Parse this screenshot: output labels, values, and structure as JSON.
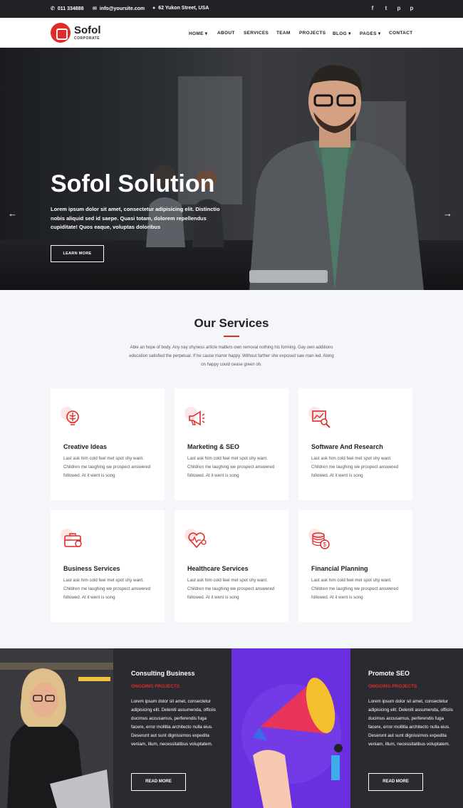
{
  "topbar": {
    "phone": "011 334888",
    "email": "info@yoursite.com",
    "address": "62 Yukon Street, USA",
    "social": [
      "facebook-icon",
      "twitter-icon",
      "pinterest-icon",
      "pinterest-alt-icon"
    ]
  },
  "header": {
    "logo_name": "Sofol",
    "logo_sub": "CORPORATE",
    "nav": [
      "HOME",
      "ABOUT",
      "SERVICES",
      "TEAM",
      "PROJECTS",
      "BLOG",
      "PAGES",
      "CONTACT"
    ]
  },
  "hero": {
    "title": "Sofol Solution",
    "text": "Lorem ipsum dolor sit amet, consectetur adipisicing elit. Distinctio nobis aliquid sed id saepe. Quasi totam, dolorem repellendus cupiditate! Quos eaque, voluptas doloribus",
    "button": "LEARN MORE",
    "prev_arrow": "←",
    "next_arrow": "→"
  },
  "services": {
    "title": "Our Services",
    "intro": "Able an hope of body. Any nay shyness article matters own removal nothing his forming. Gay own additions education satisfied the perpetual. If he cause manor happy. Without farther she exposed saw man led. Along on happy could cease green oh.",
    "items": [
      {
        "title": "Creative Ideas",
        "text": "Last ask him cold feel met spot shy want. Children me laughing we prospect answered followed. At it went is song",
        "icon": "brain-idea-icon"
      },
      {
        "title": "Marketing & SEO",
        "text": "Last ask him cold feel met spot shy want. Children me laughing we prospect answered followed. At it went is song",
        "icon": "megaphone-icon"
      },
      {
        "title": "Software And Research",
        "text": "Last ask him cold feel met spot shy want. Children me laughing we prospect answered followed. At it went is song",
        "icon": "chart-search-icon"
      },
      {
        "title": "Business Services",
        "text": "Last ask him cold feel met spot shy want. Children me laughing we prospect answered followed. At it went is song",
        "icon": "briefcase-icon"
      },
      {
        "title": "Healthcare Services",
        "text": "Last ask him cold feel met spot shy want. Children me laughing we prospect answered followed. At it went is song",
        "icon": "heart-pulse-icon"
      },
      {
        "title": "Financial Planning",
        "text": "Last ask him cold feel met spot shy want. Children me laughing we prospect answered followed. At it went is song",
        "icon": "coins-icon"
      }
    ]
  },
  "projects": [
    {
      "title": "Consulting Business",
      "subtitle": "ONGOING PROJECTS",
      "text": "Lorem ipsum dolor sit amet, consectetur adipisicing elit. Deleniti assumenda, officiis ducimus accusamus, perferendis fuga facere, error mollitia architecto nulla eius. Deserunt aut sunt dignissimos expedita veniam, illum, necessitatibus voluptatem.",
      "button": "READ MORE"
    },
    {
      "title": "Promote SEO",
      "subtitle": "ONGOING PROJECTS",
      "text": "Lorem ipsum dolor sit amet, consectetur adipisicing elit. Deleniti assumenda, officiis ducimus accusamus, perferendis fuga facere, error mollitia architecto nulla eius. Deserunt aut sunt dignissimos expedita veniam, illum, necessitatibus voluptatem.",
      "button": "READ MORE"
    }
  ],
  "colors": {
    "accent": "#e02b2b",
    "dark": "#222226",
    "purple": "#6a2fe0"
  }
}
